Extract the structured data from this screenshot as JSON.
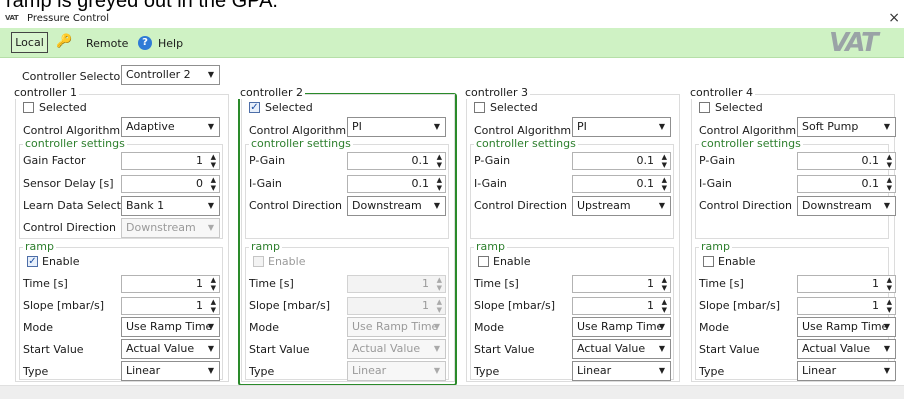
{
  "caption": "ramp is greyed out in the GPA.",
  "window": {
    "title": "Pressure Control",
    "app_icon": "VAT",
    "close_glyph": "×"
  },
  "toolbar": {
    "local_label": "Local",
    "remote_label": "Remote",
    "help_label": "Help",
    "help_glyph": "?",
    "key_glyph": "🔑",
    "logo_text": "VAT"
  },
  "selector": {
    "label": "Controller Selector",
    "value": "Controller 2"
  },
  "glyphs": {
    "combo_arrow": "▼",
    "spin_arrows_up": "▲",
    "spin_arrows_down": "▼",
    "check": "✓"
  },
  "labels": {
    "selected": "Selected",
    "control_algorithm": "Control Algorithm",
    "controller_settings": "controller settings",
    "ramp": "ramp",
    "enable": "Enable",
    "time": "Time [s]",
    "slope": "Slope [mbar/s]",
    "mode": "Mode",
    "start_value": "Start Value",
    "type": "Type"
  },
  "controllers": [
    {
      "title": "controller 1",
      "selected": false,
      "algorithm": "Adaptive",
      "settings": [
        {
          "label": "Gain Factor",
          "kind": "spin",
          "value": "1"
        },
        {
          "label": "Sensor Delay [s]",
          "kind": "spin",
          "value": "0"
        },
        {
          "label": "Learn Data Selection",
          "kind": "combo",
          "value": "Bank 1"
        },
        {
          "label": "Control Direction",
          "kind": "combo",
          "value": "Downstream",
          "disabled": true
        }
      ],
      "ramp": {
        "enable": true,
        "time": "1",
        "slope": "1",
        "mode": "Use Ramp Time",
        "start_value": "Actual Value",
        "type": "Linear",
        "disabled": false
      }
    },
    {
      "title": "controller 2",
      "selected": true,
      "algorithm": "PI",
      "settings": [
        {
          "label": "P-Gain",
          "kind": "spin",
          "value": "0.1"
        },
        {
          "label": "I-Gain",
          "kind": "spin",
          "value": "0.1"
        },
        {
          "label": "Control Direction",
          "kind": "combo",
          "value": "Downstream"
        }
      ],
      "ramp": {
        "enable": false,
        "time": "1",
        "slope": "1",
        "mode": "Use Ramp Time",
        "start_value": "Actual Value",
        "type": "Linear",
        "disabled": true
      }
    },
    {
      "title": "controller 3",
      "selected": false,
      "algorithm": "PI",
      "settings": [
        {
          "label": "P-Gain",
          "kind": "spin",
          "value": "0.1"
        },
        {
          "label": "I-Gain",
          "kind": "spin",
          "value": "0.1"
        },
        {
          "label": "Control Direction",
          "kind": "combo",
          "value": "Upstream"
        }
      ],
      "ramp": {
        "enable": false,
        "time": "1",
        "slope": "1",
        "mode": "Use Ramp Time",
        "start_value": "Actual Value",
        "type": "Linear",
        "disabled": false
      }
    },
    {
      "title": "controller 4",
      "selected": false,
      "algorithm": "Soft Pump",
      "settings": [
        {
          "label": "P-Gain",
          "kind": "spin",
          "value": "0.1"
        },
        {
          "label": "I-Gain",
          "kind": "spin",
          "value": "0.1"
        },
        {
          "label": "Control Direction",
          "kind": "combo",
          "value": "Downstream"
        }
      ],
      "ramp": {
        "enable": false,
        "time": "1",
        "slope": "1",
        "mode": "Use Ramp Time",
        "start_value": "Actual Value",
        "type": "Linear",
        "disabled": false
      }
    }
  ],
  "colors": {
    "toolbar_bg": "#cff2c4",
    "active_border": "#2a8a2a",
    "group_title_green": "#2d7f2d",
    "help_blue": "#2f7bd6"
  }
}
